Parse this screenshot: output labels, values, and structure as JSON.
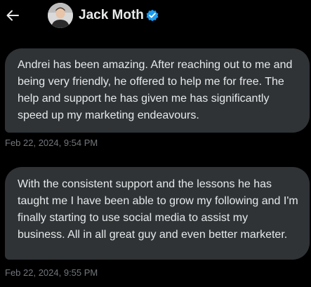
{
  "header": {
    "name": "Jack Moth",
    "back_icon": "arrow-left-icon",
    "verified_icon": "verified-badge-icon",
    "verified_color": "#1d9bf0"
  },
  "messages": [
    {
      "text": "Andrei has been amazing. After reaching out to me and being very friendly, he offered to help me for free. The help and support he has given me has significantly speed up my marketing endeavours.",
      "timestamp": "Feb 22, 2024, 9:54 PM"
    },
    {
      "text": "With the consistent support and the lessons he has taught me I have been able to grow my following and I'm finally starting to use social media to assist my business. All in all great guy and even better marketer.",
      "timestamp": "Feb 22, 2024, 9:55 PM"
    }
  ]
}
